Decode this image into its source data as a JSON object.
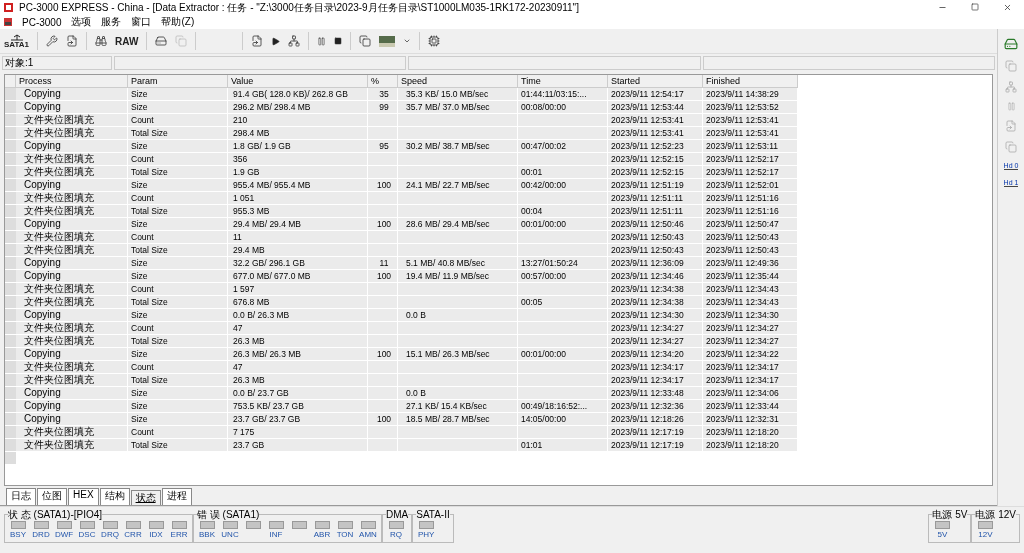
{
  "window": {
    "title": "PC-3000 EXPRESS - China - [Data Extractor : 任务 - \"Z:\\3000任务目录\\2023-9月任务目录\\ST1000LM035-1RK172-20230911\"]"
  },
  "menu": [
    "PC-3000",
    "选项",
    "服务",
    "窗口",
    "帮助(Z)"
  ],
  "toolbar": {
    "port_label": "SATA1",
    "raw_label": "RAW"
  },
  "fields": [
    "对象:1"
  ],
  "table": {
    "columns": [
      "Process",
      "Param",
      "Value",
      "%",
      "Speed",
      "Time",
      "Started",
      "Finished"
    ],
    "rows": [
      [
        "Copying",
        "Size",
        "91.4 GB( 128.0 KB)/ 262.8 GB",
        "35",
        "35.3 KB/ 15.0 MB/sec",
        "01:44:11/03:15:...",
        "2023/9/11 12:54:17",
        "2023/9/11 14:38:29"
      ],
      [
        "Copying",
        "Size",
        "296.2 MB/ 298.4 MB",
        "99",
        "35.7 MB/ 37.0 MB/sec",
        "00:08/00:00",
        "2023/9/11 12:53:44",
        "2023/9/11 12:53:52"
      ],
      [
        "文件夹位图填充",
        "Count",
        "210",
        "",
        "",
        "",
        "2023/9/11 12:53:41",
        "2023/9/11 12:53:41"
      ],
      [
        "文件夹位图填充",
        "Total Size",
        "298.4 MB",
        "",
        "",
        "",
        "2023/9/11 12:53:41",
        "2023/9/11 12:53:41"
      ],
      [
        "Copying",
        "Size",
        "1.8 GB/ 1.9 GB",
        "95",
        "30.2 MB/ 38.7 MB/sec",
        "00:47/00:02",
        "2023/9/11 12:52:23",
        "2023/9/11 12:53:11"
      ],
      [
        "文件夹位图填充",
        "Count",
        "356",
        "",
        "",
        "",
        "2023/9/11 12:52:15",
        "2023/9/11 12:52:17"
      ],
      [
        "文件夹位图填充",
        "Total Size",
        "1.9 GB",
        "",
        "",
        "00:01",
        "2023/9/11 12:52:15",
        "2023/9/11 12:52:17"
      ],
      [
        "Copying",
        "Size",
        "955.4 MB/ 955.4 MB",
        "100",
        "24.1 MB/ 22.7 MB/sec",
        "00:42/00:00",
        "2023/9/11 12:51:19",
        "2023/9/11 12:52:01"
      ],
      [
        "文件夹位图填充",
        "Count",
        "1 051",
        "",
        "",
        "",
        "2023/9/11 12:51:11",
        "2023/9/11 12:51:16"
      ],
      [
        "文件夹位图填充",
        "Total Size",
        "955.3 MB",
        "",
        "",
        "00:04",
        "2023/9/11 12:51:11",
        "2023/9/11 12:51:16"
      ],
      [
        "Copying",
        "Size",
        "29.4 MB/ 29.4 MB",
        "100",
        "28.6 MB/ 29.4 MB/sec",
        "00:01/00:00",
        "2023/9/11 12:50:46",
        "2023/9/11 12:50:47"
      ],
      [
        "文件夹位图填充",
        "Count",
        "11",
        "",
        "",
        "",
        "2023/9/11 12:50:43",
        "2023/9/11 12:50:43"
      ],
      [
        "文件夹位图填充",
        "Total Size",
        "29.4 MB",
        "",
        "",
        "",
        "2023/9/11 12:50:43",
        "2023/9/11 12:50:43"
      ],
      [
        "Copying",
        "Size",
        "32.2 GB/ 296.1 GB",
        "11",
        "5.1 MB/ 40.8 MB/sec",
        "13:27/01:50:24",
        "2023/9/11 12:36:09",
        "2023/9/11 12:49:36"
      ],
      [
        "Copying",
        "Size",
        "677.0 MB/ 677.0 MB",
        "100",
        "19.4 MB/ 11.9 MB/sec",
        "00:57/00:00",
        "2023/9/11 12:34:46",
        "2023/9/11 12:35:44"
      ],
      [
        "文件夹位图填充",
        "Count",
        "1 597",
        "",
        "",
        "",
        "2023/9/11 12:34:38",
        "2023/9/11 12:34:43"
      ],
      [
        "文件夹位图填充",
        "Total Size",
        "676.8 MB",
        "",
        "",
        "00:05",
        "2023/9/11 12:34:38",
        "2023/9/11 12:34:43"
      ],
      [
        "Copying",
        "Size",
        "0.0 B/ 26.3 MB",
        "",
        "0.0 B",
        "",
        "2023/9/11 12:34:30",
        "2023/9/11 12:34:30"
      ],
      [
        "文件夹位图填充",
        "Count",
        "47",
        "",
        "",
        "",
        "2023/9/11 12:34:27",
        "2023/9/11 12:34:27"
      ],
      [
        "文件夹位图填充",
        "Total Size",
        "26.3 MB",
        "",
        "",
        "",
        "2023/9/11 12:34:27",
        "2023/9/11 12:34:27"
      ],
      [
        "Copying",
        "Size",
        "26.3 MB/ 26.3 MB",
        "100",
        "15.1 MB/ 26.3 MB/sec",
        "00:01/00:00",
        "2023/9/11 12:34:20",
        "2023/9/11 12:34:22"
      ],
      [
        "文件夹位图填充",
        "Count",
        "47",
        "",
        "",
        "",
        "2023/9/11 12:34:17",
        "2023/9/11 12:34:17"
      ],
      [
        "文件夹位图填充",
        "Total Size",
        "26.3 MB",
        "",
        "",
        "",
        "2023/9/11 12:34:17",
        "2023/9/11 12:34:17"
      ],
      [
        "Copying",
        "Size",
        "0.0 B/ 23.7 GB",
        "",
        "0.0 B",
        "",
        "2023/9/11 12:33:48",
        "2023/9/11 12:34:06"
      ],
      [
        "Copying",
        "Size",
        "753.5 KB/ 23.7 GB",
        "",
        "27.1 KB/ 15.4 KB/sec",
        "00:49/18:16:52:...",
        "2023/9/11 12:32:36",
        "2023/9/11 12:33:44"
      ],
      [
        "Copying",
        "Size",
        "23.7 GB/ 23.7 GB",
        "100",
        "18.5 MB/ 28.7 MB/sec",
        "14:05/00:00",
        "2023/9/11 12:18:26",
        "2023/9/11 12:32:31"
      ],
      [
        "文件夹位图填充",
        "Count",
        "7 175",
        "",
        "",
        "",
        "2023/9/11 12:17:19",
        "2023/9/11 12:18:20"
      ],
      [
        "文件夹位图填充",
        "Total Size",
        "23.7 GB",
        "",
        "",
        "01:01",
        "2023/9/11 12:17:19",
        "2023/9/11 12:18:20"
      ]
    ]
  },
  "tabs": [
    {
      "label": "日志",
      "selected": false
    },
    {
      "label": "位图",
      "selected": false
    },
    {
      "label": "HEX",
      "selected": false
    },
    {
      "label": "结构",
      "selected": false
    },
    {
      "label": "状态",
      "selected": true
    },
    {
      "label": "进程",
      "selected": false
    }
  ],
  "side_panel": [
    "Hd 0",
    "Hd 1"
  ],
  "indicator_groups": [
    {
      "title": "状 态 (SATA1)-[PIO4]",
      "leds": [
        {
          "label": "BSY",
          "on": false
        },
        {
          "label": "DRD",
          "on": false
        },
        {
          "label": "DWF",
          "on": false
        },
        {
          "label": "DSC",
          "on": false
        },
        {
          "label": "DRQ",
          "on": false
        },
        {
          "label": "CRR",
          "on": false
        },
        {
          "label": "IDX",
          "on": false
        },
        {
          "label": "ERR",
          "on": false
        }
      ]
    },
    {
      "title": "错 误 (SATA1)",
      "leds": [
        {
          "label": "BBK",
          "on": false
        },
        {
          "label": "UNC",
          "on": false
        },
        {
          "on": false
        },
        {
          "label": "INF",
          "on": false
        },
        {
          "on": false
        },
        {
          "label": "ABR",
          "on": false
        },
        {
          "label": "TON",
          "on": false
        },
        {
          "label": "AMN",
          "on": false
        }
      ]
    },
    {
      "title": "DMA",
      "leds": [
        {
          "label": "RQ",
          "on": false
        }
      ]
    },
    {
      "title": "SATA-II",
      "leds": [
        {
          "label": "PHY",
          "on": false
        }
      ]
    }
  ],
  "power_groups": [
    {
      "title": "电源 5V",
      "leds": [
        {
          "label": "5V",
          "on": false
        }
      ]
    },
    {
      "title": "电源 12V",
      "leds": [
        {
          "label": "12V",
          "on": false
        }
      ]
    }
  ]
}
